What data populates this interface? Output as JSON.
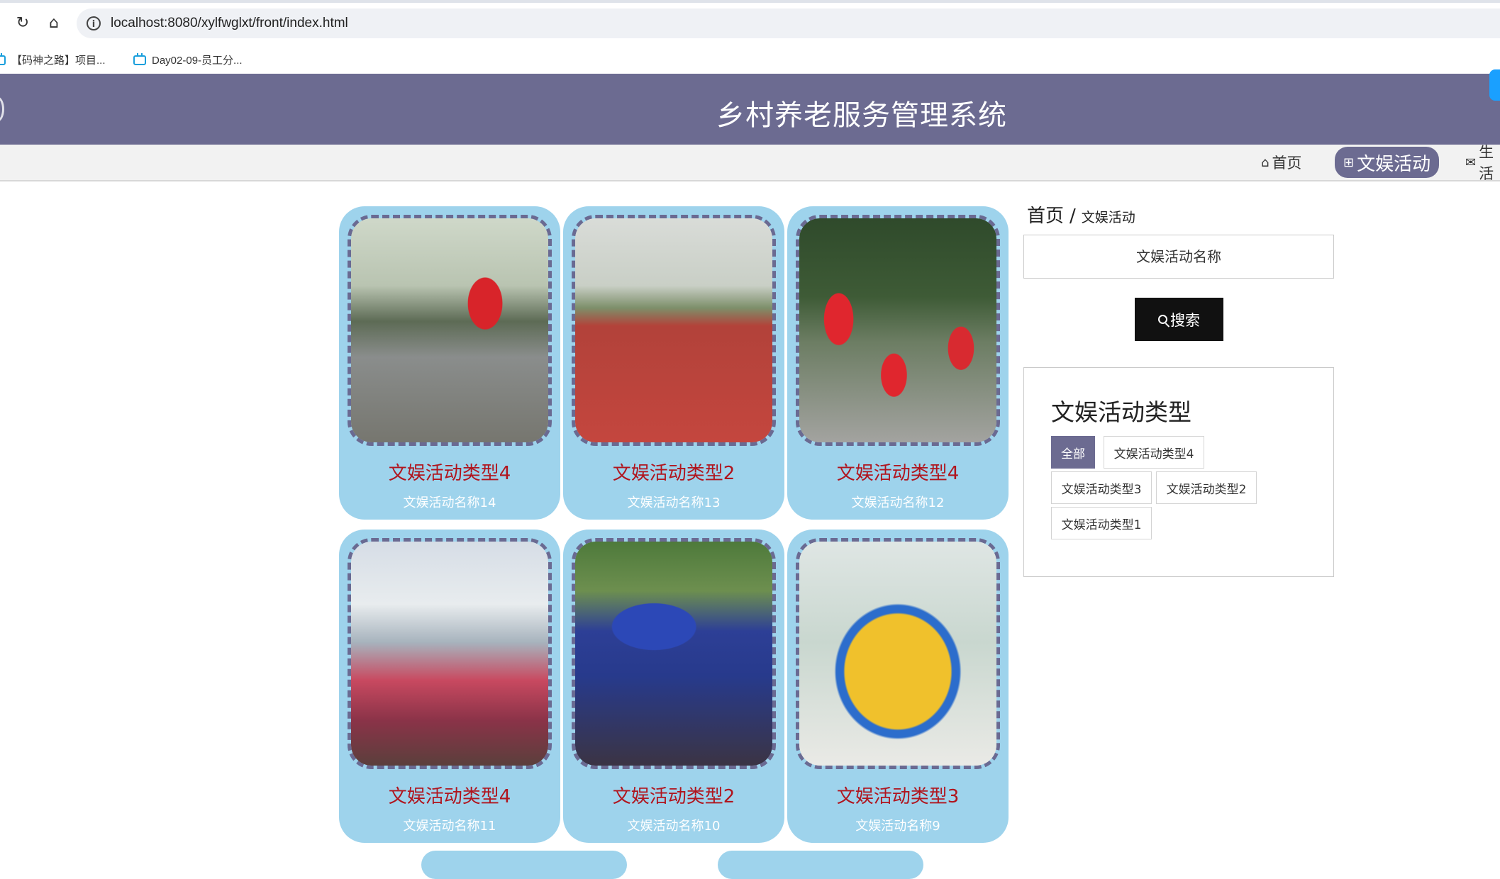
{
  "browser": {
    "url": "localhost:8080/xylfwglxt/front/index.html",
    "bookmarks": [
      {
        "label": "【码神之路】项目..."
      },
      {
        "label": "Day02-09-员工分..."
      }
    ]
  },
  "site": {
    "title": "乡村养老服务管理系统"
  },
  "nav": {
    "items": [
      {
        "label": "首页",
        "icon": "home-icon"
      },
      {
        "label": "文娱活动",
        "icon": "gift-icon",
        "active": true
      },
      {
        "label": "生活",
        "icon": "mail-icon"
      }
    ]
  },
  "activities": [
    {
      "type": "文娱活动类型4",
      "name": "文娱活动名称14"
    },
    {
      "type": "文娱活动类型2",
      "name": "文娱活动名称13"
    },
    {
      "type": "文娱活动类型4",
      "name": "文娱活动名称12"
    },
    {
      "type": "文娱活动类型4",
      "name": "文娱活动名称11"
    },
    {
      "type": "文娱活动类型2",
      "name": "文娱活动名称10"
    },
    {
      "type": "文娱活动类型3",
      "name": "文娱活动名称9"
    }
  ],
  "sidebar": {
    "breadcrumb": {
      "home": "首页",
      "separator": "/",
      "current": "文娱活动"
    },
    "search": {
      "placeholder": "文娱活动名称",
      "button_label": "搜索"
    },
    "categories": {
      "title": "文娱活动类型",
      "tags": [
        "全部",
        "文娱活动类型4",
        "文娱活动类型3",
        "文娱活动类型2",
        "文娱活动类型1"
      ],
      "active": "全部"
    }
  },
  "colors": {
    "brand": "#6c6b91",
    "card_bg": "#9ed3ec",
    "card_title": "#b0151e",
    "search_button": "#111111"
  }
}
